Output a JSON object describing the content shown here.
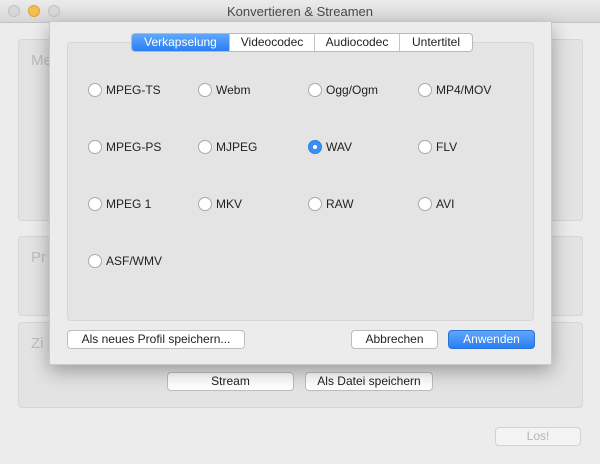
{
  "window": {
    "title": "Konvertieren & Streamen"
  },
  "background": {
    "box1_label": "Me",
    "box2_label": "Pr",
    "box3_label": "Zi",
    "stream_button": "Stream",
    "save_file_button": "Als Datei speichern",
    "go_button": "Los!"
  },
  "dialog": {
    "tabs": [
      {
        "label": "Verkapselung",
        "active": true
      },
      {
        "label": "Videocodec",
        "active": false
      },
      {
        "label": "Audiocodec",
        "active": false
      },
      {
        "label": "Untertitel",
        "active": false
      }
    ],
    "options": [
      {
        "label": "MPEG-TS",
        "selected": false
      },
      {
        "label": "Webm",
        "selected": false
      },
      {
        "label": "Ogg/Ogm",
        "selected": false
      },
      {
        "label": "MP4/MOV",
        "selected": false
      },
      {
        "label": "MPEG-PS",
        "selected": false
      },
      {
        "label": "MJPEG",
        "selected": false
      },
      {
        "label": "WAV",
        "selected": true
      },
      {
        "label": "FLV",
        "selected": false
      },
      {
        "label": "MPEG 1",
        "selected": false
      },
      {
        "label": "MKV",
        "selected": false
      },
      {
        "label": "RAW",
        "selected": false
      },
      {
        "label": "AVI",
        "selected": false
      },
      {
        "label": "ASF/WMV",
        "selected": false
      }
    ],
    "save_profile_button": "Als neues Profil speichern...",
    "cancel_button": "Abbrechen",
    "apply_button": "Anwenden"
  }
}
